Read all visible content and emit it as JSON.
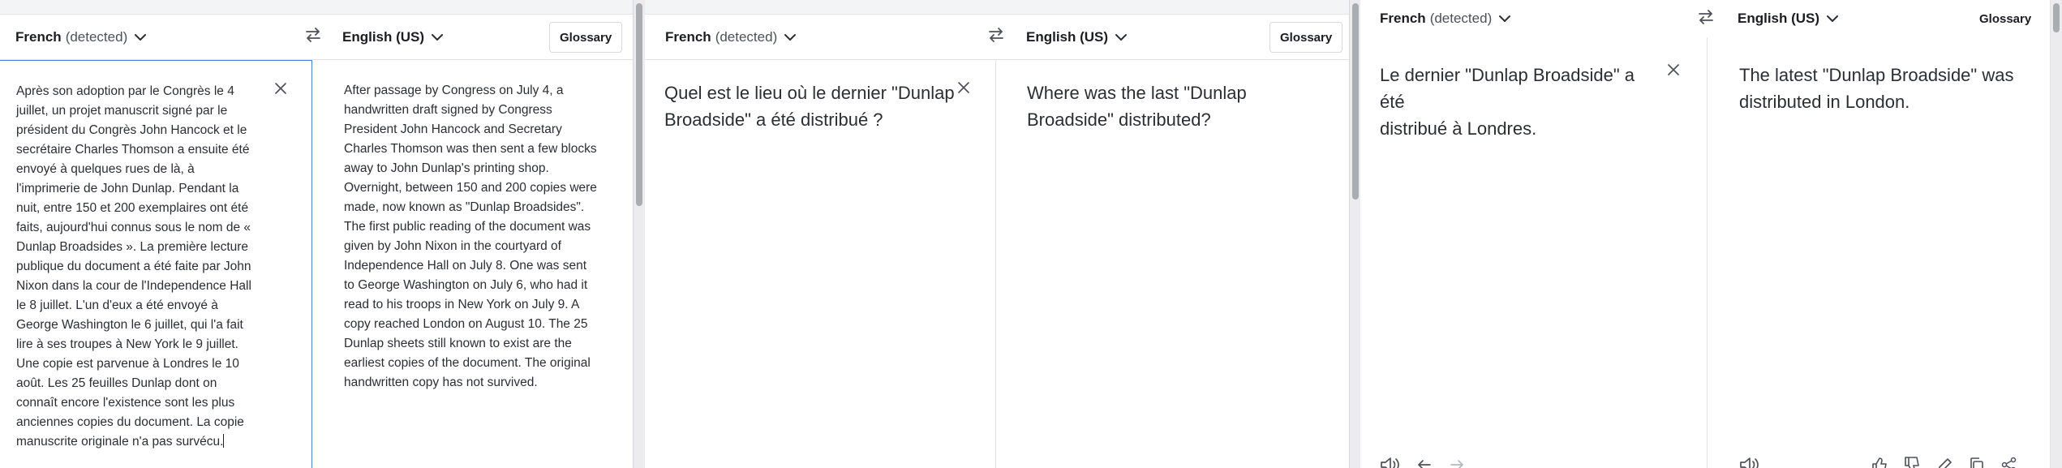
{
  "panels": [
    {
      "source_lang": "French",
      "source_detected": "(detected)",
      "target_lang": "English (US)",
      "glossary_label": "Glossary",
      "source_text": "Après son adoption par le Congrès le 4\njuillet, un projet manuscrit signé par le\nprésident du Congrès John Hancock et le\nsecrétaire Charles Thomson a ensuite été\nenvoyé à quelques rues de là, à\nl'imprimerie de John Dunlap. Pendant la\nnuit, entre 150 et 200 exemplaires ont été\nfaits, aujourd'hui connus sous le nom de «\nDunlap Broadsides ». La première lecture\npublique du document a été faite par John\nNixon dans la cour de l'Independence Hall\nle 8 juillet. L'un d'eux a été envoyé à\nGeorge Washington le 6 juillet, qui l'a fait\nlire à ses troupes à New York le 9 juillet.\nUne copie est parvenue à Londres le 10\naoût. Les 25 feuilles Dunlap dont on\nconnaît encore l'existence sont les plus\nanciennes copies du document. La copie\nmanuscrite originale n'a pas survécu.",
      "target_text": "After passage by Congress on July 4, a\nhandwritten draft signed by Congress\nPresident John Hancock and Secretary\nCharles Thomson was then sent a few blocks\naway to John Dunlap's printing shop.\nOvernight, between 150 and 200 copies were\nmade, now known as \"Dunlap Broadsides\".\nThe first public reading of the document was\ngiven by John Nixon in the courtyard of\nIndependence Hall on July 8. One was sent\nto George Washington on July 6, who had it\nread to his troops in New York on July 9. A\ncopy reached London on August 10. The 25\nDunlap sheets still known to exist are the\nearliest copies of the document. The original\nhandwritten copy has not survived."
    },
    {
      "source_lang": "French",
      "source_detected": "(detected)",
      "target_lang": "English (US)",
      "glossary_label": "Glossary",
      "source_text": "Quel est le lieu où le dernier \"Dunlap\nBroadside\" a été distribué ?",
      "target_text": "Where was the last \"Dunlap\nBroadside\" distributed?"
    },
    {
      "source_lang": "French",
      "source_detected": "(detected)",
      "target_lang": "English (US)",
      "glossary_label": "Glossary",
      "source_text": "Le dernier \"Dunlap Broadside\" a été\ndistribué à Londres.",
      "target_text": "The latest \"Dunlap Broadside\" was\ndistributed in London."
    }
  ],
  "icons": {
    "chevron": "chevron-down-icon",
    "swap": "swap-languages-icon",
    "clear": "close-icon",
    "speaker": "speaker-icon",
    "undo": "undo-icon",
    "redo": "redo-icon",
    "thumbs_up": "thumbs-up-icon",
    "thumbs_down": "thumbs-down-icon",
    "copy": "copy-icon",
    "edit": "edit-icon",
    "share": "share-icon"
  },
  "colors": {
    "active_border": "#4a7fd1",
    "divider": "#dfe1e4",
    "text": "#2b2e33",
    "scroll_thumb": "#a9acb1"
  }
}
